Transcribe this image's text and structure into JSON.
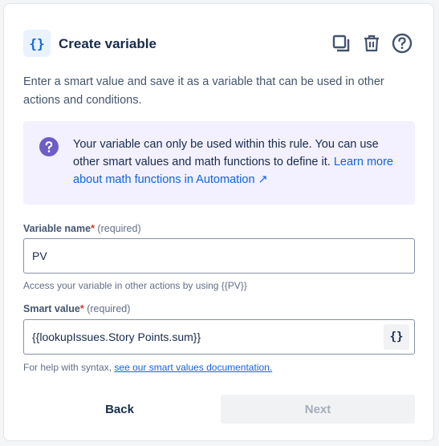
{
  "header": {
    "icon": "braces-icon",
    "icon_glyph": "{}",
    "title": "Create variable",
    "actions": [
      "duplicate-icon",
      "trash-icon",
      "help-icon"
    ]
  },
  "description": "Enter a smart value and save it as a variable that can be used in other actions and conditions.",
  "info": {
    "icon": "question-icon",
    "text": "Your variable can only be used within this rule. You can use other smart values and math functions to define it. ",
    "link": "Learn more about math functions in Automation ↗"
  },
  "variable_name": {
    "label": "Variable name",
    "required_mark": "*",
    "required_text": " (required)",
    "value": "PV",
    "helper": "Access your variable in other actions by using {{PV}}"
  },
  "smart_value": {
    "label": "Smart value",
    "required_mark": "*",
    "required_text": " (required)",
    "value": "{{lookupIssues.Story Points.sum}}",
    "button_glyph": "{}",
    "helper_prefix": "For help with syntax, ",
    "helper_link": "see our smart values documentation."
  },
  "footer": {
    "back_label": "Back",
    "next_label": "Next"
  },
  "colors": {
    "accent": "#0c66e4",
    "info_bg": "#f3f0ff",
    "info_icon": "#6e5dc6",
    "required": "#c9372c"
  }
}
